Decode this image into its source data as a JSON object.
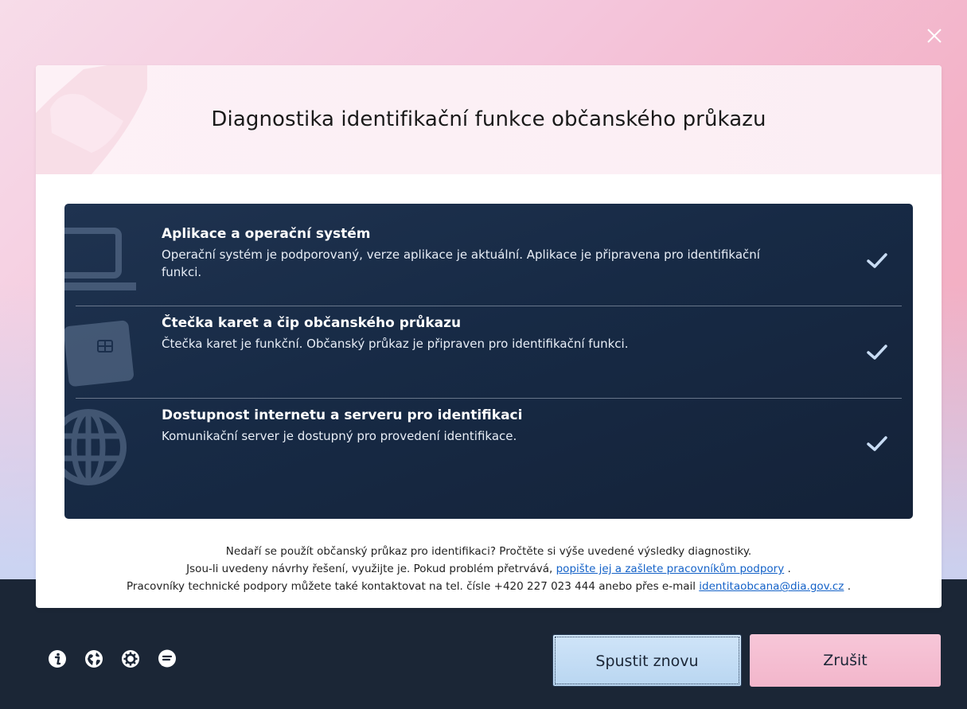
{
  "window": {
    "close_icon": "close-icon"
  },
  "header": {
    "title": "Diagnostika identifikační funkce občanského průkazu"
  },
  "checks": [
    {
      "icon": "laptop-icon",
      "title": "Aplikace a operační systém",
      "text": "Operační systém je podporovaný, verze aplikace je aktuální. Aplikace je připravena pro identifikační funkci.",
      "status": "ok"
    },
    {
      "icon": "card-icon",
      "title": "Čtečka karet a čip občanského průkazu",
      "text": "Čtečka karet je funkční. Občanský průkaz je připraven pro identifikační funkci.",
      "status": "ok"
    },
    {
      "icon": "globe-icon",
      "title": "Dostupnost internetu a serveru pro identifikaci",
      "text": "Komunikační server je dostupný pro provedení identifikace.",
      "status": "ok"
    }
  ],
  "help": {
    "line1": "Nedaří se použít občanský průkaz pro identifikaci? Pročtěte si výše uvedené výsledky diagnostiky.",
    "line2_before": "Jsou-li uvedeny návrhy řešení, využijte je. Pokud problém přetrvává, ",
    "line2_link": "popište jej a zašlete pracovníkům podpory",
    "line2_after": " .",
    "line3_before": "Pracovníky technické podpory můžete také kontaktovat na tel. čísle +420 227 023 444 anebo přes e-mail ",
    "line3_link": "identitaobcana@dia.gov.cz",
    "line3_after": " ."
  },
  "footer": {
    "icons": [
      "info-icon",
      "globe-icon",
      "settings-icon",
      "chat-icon"
    ],
    "rerun_label": "Spustit znovu",
    "cancel_label": "Zrušit"
  },
  "colors": {
    "panel": "#172a45",
    "footer": "#1b2636",
    "rerun_button": "#cfe4f8",
    "cancel_button": "#f7c6d8",
    "link": "#1462c8"
  }
}
